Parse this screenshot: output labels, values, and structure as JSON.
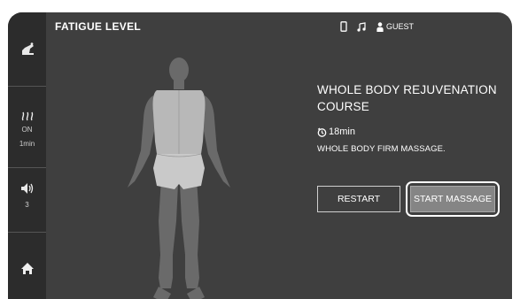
{
  "header": {
    "title": "FATIGUE LEVEL"
  },
  "status": {
    "user": "GUEST",
    "icons": [
      "phone-icon",
      "music-note-icon",
      "person-icon"
    ]
  },
  "sidebar": {
    "items": [
      {
        "name": "massage-chair",
        "icon": "massage-chair-icon"
      },
      {
        "name": "heat",
        "icon": "heat-icon",
        "state": "ON",
        "duration": "1min"
      },
      {
        "name": "volume",
        "icon": "speaker-icon",
        "level": "3"
      },
      {
        "name": "home",
        "icon": "home-icon"
      }
    ]
  },
  "course": {
    "name": "WHOLE BODY REJUVENATION COURSE",
    "duration": "18min",
    "description": "WHOLE BODY FIRM MASSAGE."
  },
  "buttons": {
    "restart": "RESTART",
    "start": "START MASSAGE"
  },
  "colors": {
    "screen": "#3f3f3f",
    "sidebar": "#2c2c2c",
    "figure": "#6a6a6a",
    "highlight": "#b8b8b8",
    "start_button": "#858585"
  }
}
